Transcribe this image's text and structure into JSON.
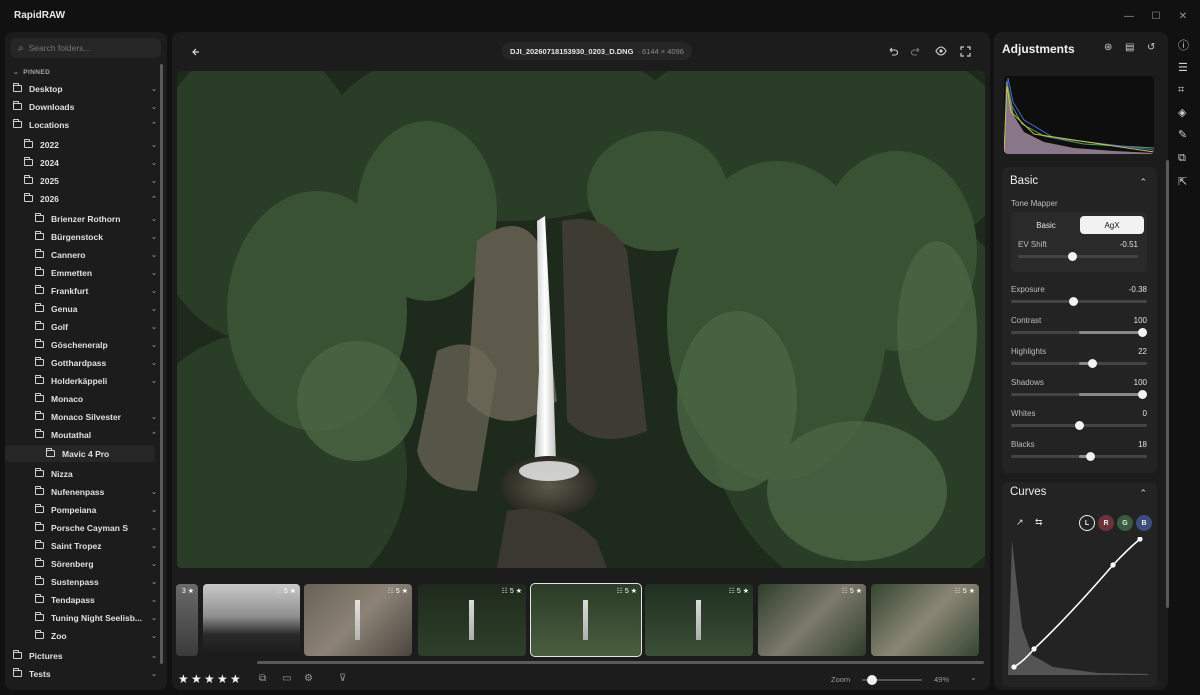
{
  "app": {
    "title": "RapidRAW"
  },
  "window": {
    "min": "—",
    "max": "☐",
    "close": "✕"
  },
  "sidebar": {
    "search_placeholder": "Search folders...",
    "pinned_label": "PINNED",
    "items": [
      {
        "label": "Desktop"
      },
      {
        "label": "Downloads"
      },
      {
        "label": "Locations"
      },
      {
        "label": "2022"
      },
      {
        "label": "2024"
      },
      {
        "label": "2025"
      },
      {
        "label": "2026"
      },
      {
        "label": "Brienzer Rothorn"
      },
      {
        "label": "Bürgenstock"
      },
      {
        "label": "Cannero"
      },
      {
        "label": "Emmetten"
      },
      {
        "label": "Frankfurt"
      },
      {
        "label": "Genua"
      },
      {
        "label": "Golf"
      },
      {
        "label": "Göscheneralp"
      },
      {
        "label": "Gotthardpass"
      },
      {
        "label": "Holderkäppeli"
      },
      {
        "label": "Monaco"
      },
      {
        "label": "Monaco Silvester"
      },
      {
        "label": "Moutathal"
      },
      {
        "label": "Mavic 4 Pro"
      },
      {
        "label": "Nizza"
      },
      {
        "label": "Nufenenpass"
      },
      {
        "label": "Pompeiana"
      },
      {
        "label": "Porsche Cayman S"
      },
      {
        "label": "Saint Tropez"
      },
      {
        "label": "Sörenberg"
      },
      {
        "label": "Sustenpass"
      },
      {
        "label": "Tendapass"
      },
      {
        "label": "Tuning Night Seelisb..."
      },
      {
        "label": "Zoo"
      },
      {
        "label": "Pictures"
      },
      {
        "label": "Tests"
      }
    ]
  },
  "editor": {
    "filename": "DJI_20260718153930_0203_D.DNG",
    "dimensions": "· 6144 × 4096",
    "thumbs": [
      {
        "rating": "3"
      },
      {
        "rating": "5"
      },
      {
        "rating": "5"
      },
      {
        "rating": "5"
      },
      {
        "rating": "5"
      },
      {
        "rating": "5"
      },
      {
        "rating": "5"
      },
      {
        "rating": "5"
      }
    ],
    "zoom_label": "Zoom",
    "zoom_value": "49%",
    "zoom_fraction": 0.1
  },
  "adjustments": {
    "title": "Adjustments",
    "basic": {
      "title": "Basic",
      "tone_mapper_label": "Tone Mapper",
      "tm_basic": "Basic",
      "tm_agx": "AgX",
      "sliders": [
        {
          "label": "EV Shift",
          "value": "-0.51",
          "fraction": 0.45
        },
        {
          "label": "Exposure",
          "value": "-0.38",
          "fraction": 0.46
        },
        {
          "label": "Contrast",
          "value": "100",
          "fraction": 1.0
        },
        {
          "label": "Highlights",
          "value": "22",
          "fraction": 0.61
        },
        {
          "label": "Shadows",
          "value": "100",
          "fraction": 1.0
        },
        {
          "label": "Whites",
          "value": "0",
          "fraction": 0.5
        },
        {
          "label": "Blacks",
          "value": "18",
          "fraction": 0.59
        }
      ]
    },
    "curves": {
      "title": "Curves",
      "channels": [
        "L",
        "R",
        "G",
        "B"
      ]
    }
  },
  "colors": {
    "accent": "#f2f2f2",
    "panel": "#1c1c1d",
    "card": "#232324",
    "red_channel": "#6b3237",
    "green_channel": "#3c5a3e",
    "blue_channel": "#3b4d7c"
  }
}
